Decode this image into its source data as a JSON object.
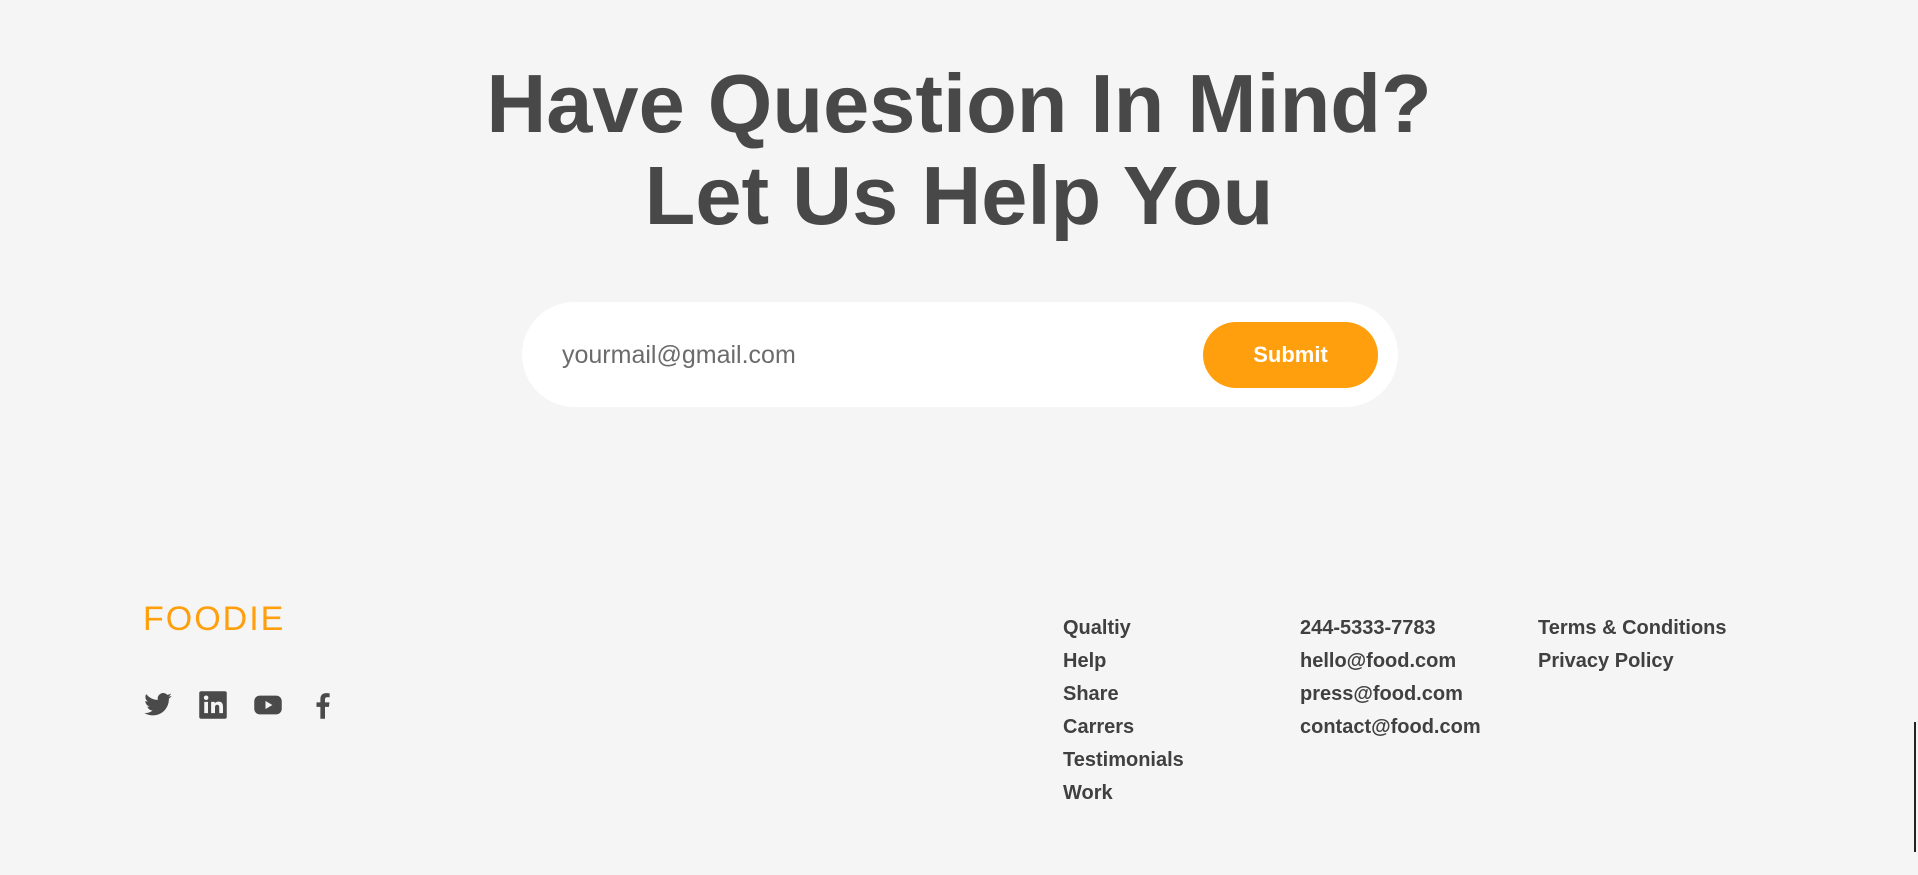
{
  "hero": {
    "line1": "Have Question In Mind?",
    "line2": "Let Us Help You"
  },
  "subscribe": {
    "placeholder": "yourmail@gmail.com",
    "submit_label": "Submit"
  },
  "footer": {
    "logo": "FOODIE",
    "socials": [
      "twitter-icon",
      "linkedin-icon",
      "youtube-icon",
      "facebook-icon"
    ],
    "links": [
      "Qualtiy",
      "Help",
      "Share",
      "Carrers",
      "Testimonials",
      "Work"
    ],
    "contacts": [
      "244-5333-7783",
      "hello@food.com",
      "press@food.com",
      "contact@food.com"
    ],
    "legal": [
      "Terms & Conditions",
      "Privacy Policy"
    ]
  },
  "colors": {
    "accent": "#ff9f0d",
    "heading": "#484848",
    "background": "#f5f5f5"
  }
}
